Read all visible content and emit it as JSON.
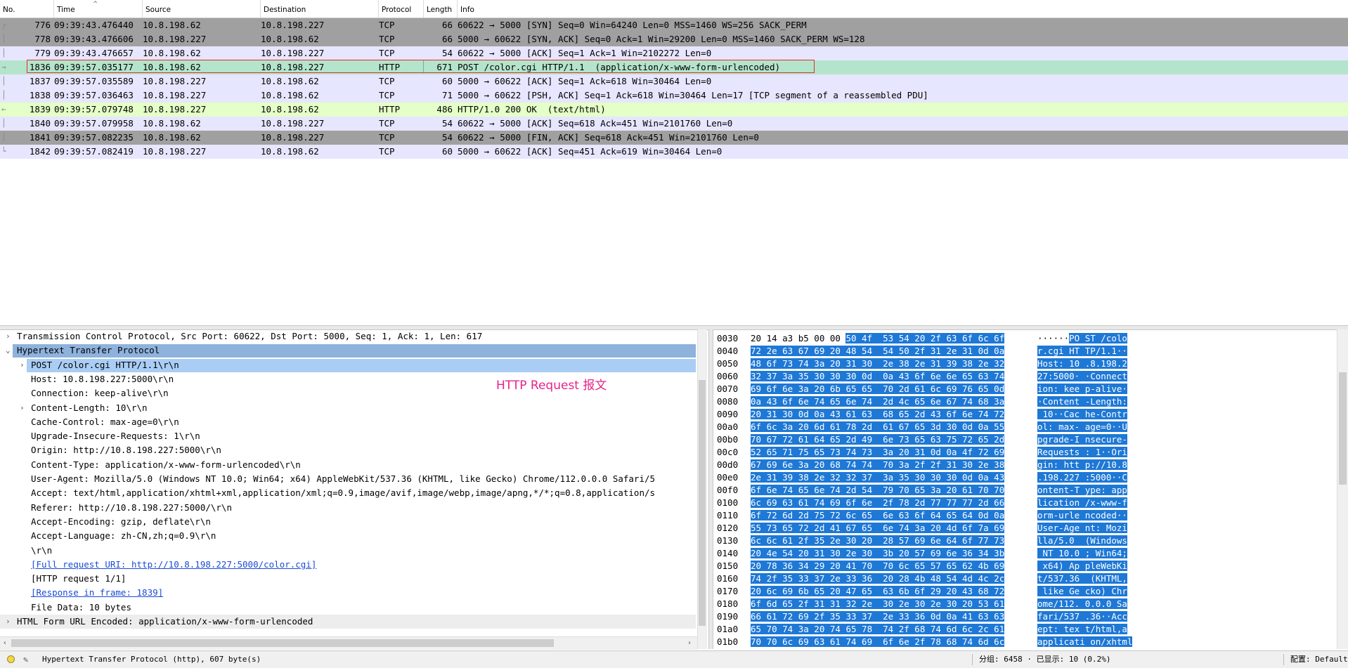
{
  "columns": [
    "No.",
    "Time",
    "Source",
    "Destination",
    "Protocol",
    "Length",
    "Info"
  ],
  "packets": [
    {
      "no": "776",
      "time": "09:39:43.476440",
      "src": "10.8.198.62",
      "dst": "10.8.198.227",
      "proto": "TCP",
      "len": "66",
      "info": "60622 → 5000 [SYN] Seq=0 Win=64240 Len=0 MSS=1460 WS=256 SACK_PERM",
      "bg": "#a0a0a0",
      "rel": "┌"
    },
    {
      "no": "778",
      "time": "09:39:43.476606",
      "src": "10.8.198.227",
      "dst": "10.8.198.62",
      "proto": "TCP",
      "len": "66",
      "info": "5000 → 60622 [SYN, ACK] Seq=0 Ack=1 Win=29200 Len=0 MSS=1460 SACK_PERM WS=128",
      "bg": "#a0a0a0",
      "rel": "│"
    },
    {
      "no": "779",
      "time": "09:39:43.476657",
      "src": "10.8.198.62",
      "dst": "10.8.198.227",
      "proto": "TCP",
      "len": "54",
      "info": "60622 → 5000 [ACK] Seq=1 Ack=1 Win=2102272 Len=0",
      "bg": "#e7e6ff",
      "rel": "│"
    },
    {
      "no": "1836",
      "time": "09:39:57.035177",
      "src": "10.8.198.62",
      "dst": "10.8.198.227",
      "proto": "HTTP",
      "len": "671",
      "info": "POST /color.cgi HTTP/1.1  (application/x-www-form-urlencoded)",
      "bg": "#b4e4cc",
      "rel": "→"
    },
    {
      "no": "1837",
      "time": "09:39:57.035589",
      "src": "10.8.198.227",
      "dst": "10.8.198.62",
      "proto": "TCP",
      "len": "60",
      "info": "5000 → 60622 [ACK] Seq=1 Ack=618 Win=30464 Len=0",
      "bg": "#e7e6ff",
      "rel": "│"
    },
    {
      "no": "1838",
      "time": "09:39:57.036463",
      "src": "10.8.198.227",
      "dst": "10.8.198.62",
      "proto": "TCP",
      "len": "71",
      "info": "5000 → 60622 [PSH, ACK] Seq=1 Ack=618 Win=30464 Len=17 [TCP segment of a reassembled PDU]",
      "bg": "#e7e6ff",
      "rel": "│"
    },
    {
      "no": "1839",
      "time": "09:39:57.079748",
      "src": "10.8.198.227",
      "dst": "10.8.198.62",
      "proto": "HTTP",
      "len": "486",
      "info": "HTTP/1.0 200 OK  (text/html)",
      "bg": "#e4ffc7",
      "rel": "←"
    },
    {
      "no": "1840",
      "time": "09:39:57.079958",
      "src": "10.8.198.62",
      "dst": "10.8.198.227",
      "proto": "TCP",
      "len": "54",
      "info": "60622 → 5000 [ACK] Seq=618 Ack=451 Win=2101760 Len=0",
      "bg": "#e7e6ff",
      "rel": "│"
    },
    {
      "no": "1841",
      "time": "09:39:57.082235",
      "src": "10.8.198.62",
      "dst": "10.8.198.227",
      "proto": "TCP",
      "len": "54",
      "info": "60622 → 5000 [FIN, ACK] Seq=618 Ack=451 Win=2101760 Len=0",
      "bg": "#a0a0a0",
      "rel": "│"
    },
    {
      "no": "1842",
      "time": "09:39:57.082419",
      "src": "10.8.198.227",
      "dst": "10.8.198.62",
      "proto": "TCP",
      "len": "60",
      "info": "5000 → 60622 [ACK] Seq=451 Ack=619 Win=30464 Len=0",
      "bg": "#e7e6ff",
      "rel": "└"
    }
  ],
  "details": [
    {
      "text": "Transmission Control Protocol, Src Port: 60622, Dst Port: 5000, Seq: 1, Ack: 1, Len: 617",
      "indent": 0,
      "arrow": "›",
      "style": "normal"
    },
    {
      "text": "Hypertext Transfer Protocol",
      "indent": 0,
      "arrow": "⌄",
      "style": "sel-dark"
    },
    {
      "text": "POST /color.cgi HTTP/1.1\\r\\n",
      "indent": 1,
      "arrow": "›",
      "style": "sel-light"
    },
    {
      "text": "Host: 10.8.198.227:5000\\r\\n",
      "indent": 1,
      "arrow": "",
      "style": "normal"
    },
    {
      "text": "Connection: keep-alive\\r\\n",
      "indent": 1,
      "arrow": "",
      "style": "normal"
    },
    {
      "text": "Content-Length: 10\\r\\n",
      "indent": 1,
      "arrow": "›",
      "style": "normal"
    },
    {
      "text": "Cache-Control: max-age=0\\r\\n",
      "indent": 1,
      "arrow": "",
      "style": "normal"
    },
    {
      "text": "Upgrade-Insecure-Requests: 1\\r\\n",
      "indent": 1,
      "arrow": "",
      "style": "normal"
    },
    {
      "text": "Origin: http://10.8.198.227:5000\\r\\n",
      "indent": 1,
      "arrow": "",
      "style": "normal"
    },
    {
      "text": "Content-Type: application/x-www-form-urlencoded\\r\\n",
      "indent": 1,
      "arrow": "",
      "style": "normal"
    },
    {
      "text": "User-Agent: Mozilla/5.0 (Windows NT 10.0; Win64; x64) AppleWebKit/537.36 (KHTML, like Gecko) Chrome/112.0.0.0 Safari/5",
      "indent": 1,
      "arrow": "",
      "style": "normal"
    },
    {
      "text": "Accept: text/html,application/xhtml+xml,application/xml;q=0.9,image/avif,image/webp,image/apng,*/*;q=0.8,application/s",
      "indent": 1,
      "arrow": "",
      "style": "normal"
    },
    {
      "text": "Referer: http://10.8.198.227:5000/\\r\\n",
      "indent": 1,
      "arrow": "",
      "style": "normal"
    },
    {
      "text": "Accept-Encoding: gzip, deflate\\r\\n",
      "indent": 1,
      "arrow": "",
      "style": "normal"
    },
    {
      "text": "Accept-Language: zh-CN,zh;q=0.9\\r\\n",
      "indent": 1,
      "arrow": "",
      "style": "normal"
    },
    {
      "text": "\\r\\n",
      "indent": 1,
      "arrow": "",
      "style": "normal"
    },
    {
      "text": "[Full request URI: http://10.8.198.227:5000/color.cgi]",
      "indent": 1,
      "arrow": "",
      "style": "link"
    },
    {
      "text": "[HTTP request 1/1]",
      "indent": 1,
      "arrow": "",
      "style": "normal"
    },
    {
      "text": "[Response in frame: 1839]",
      "indent": 1,
      "arrow": "",
      "style": "link"
    },
    {
      "text": "File Data: 10 bytes",
      "indent": 1,
      "arrow": "",
      "style": "normal"
    },
    {
      "text": "HTML Form URL Encoded: application/x-www-form-urlencoded",
      "indent": 0,
      "arrow": "›",
      "style": "grey"
    }
  ],
  "annotation": "HTTP Request 报文",
  "hex": [
    {
      "off": "0030",
      "pre": "20 14 a3 b5 00 00 ",
      "hl": "50 4f  53 54 20 2f 63 6f 6c 6f",
      "apre": "······",
      "ahl": "PO ST /colo"
    },
    {
      "off": "0040",
      "pre": "",
      "hl": "72 2e 63 67 69 20 48 54  54 50 2f 31 2e 31 0d 0a",
      "apre": "",
      "ahl": "r.cgi HT TP/1.1··"
    },
    {
      "off": "0050",
      "pre": "",
      "hl": "48 6f 73 74 3a 20 31 30  2e 38 2e 31 39 38 2e 32",
      "apre": "",
      "ahl": "Host: 10 .8.198.2"
    },
    {
      "off": "0060",
      "pre": "",
      "hl": "32 37 3a 35 30 30 30 0d  0a 43 6f 6e 6e 65 63 74",
      "apre": "",
      "ahl": "27:5000· ·Connect"
    },
    {
      "off": "0070",
      "pre": "",
      "hl": "69 6f 6e 3a 20 6b 65 65  70 2d 61 6c 69 76 65 0d",
      "apre": "",
      "ahl": "ion: kee p-alive·"
    },
    {
      "off": "0080",
      "pre": "",
      "hl": "0a 43 6f 6e 74 65 6e 74  2d 4c 65 6e 67 74 68 3a",
      "apre": "",
      "ahl": "·Content -Length:"
    },
    {
      "off": "0090",
      "pre": "",
      "hl": "20 31 30 0d 0a 43 61 63  68 65 2d 43 6f 6e 74 72",
      "apre": "",
      "ahl": " 10··Cac he-Contr"
    },
    {
      "off": "00a0",
      "pre": "",
      "hl": "6f 6c 3a 20 6d 61 78 2d  61 67 65 3d 30 0d 0a 55",
      "apre": "",
      "ahl": "ol: max- age=0··U"
    },
    {
      "off": "00b0",
      "pre": "",
      "hl": "70 67 72 61 64 65 2d 49  6e 73 65 63 75 72 65 2d",
      "apre": "",
      "ahl": "pgrade-I nsecure-"
    },
    {
      "off": "00c0",
      "pre": "",
      "hl": "52 65 71 75 65 73 74 73  3a 20 31 0d 0a 4f 72 69",
      "apre": "",
      "ahl": "Requests : 1··Ori"
    },
    {
      "off": "00d0",
      "pre": "",
      "hl": "67 69 6e 3a 20 68 74 74  70 3a 2f 2f 31 30 2e 38",
      "apre": "",
      "ahl": "gin: htt p://10.8"
    },
    {
      "off": "00e0",
      "pre": "",
      "hl": "2e 31 39 38 2e 32 32 37  3a 35 30 30 30 0d 0a 43",
      "apre": "",
      "ahl": ".198.227 :5000··C"
    },
    {
      "off": "00f0",
      "pre": "",
      "hl": "6f 6e 74 65 6e 74 2d 54  79 70 65 3a 20 61 70 70",
      "apre": "",
      "ahl": "ontent-T ype: app"
    },
    {
      "off": "0100",
      "pre": "",
      "hl": "6c 69 63 61 74 69 6f 6e  2f 78 2d 77 77 77 2d 66",
      "apre": "",
      "ahl": "lication /x-www-f"
    },
    {
      "off": "0110",
      "pre": "",
      "hl": "6f 72 6d 2d 75 72 6c 65  6e 63 6f 64 65 64 0d 0a",
      "apre": "",
      "ahl": "orm-urle ncoded··"
    },
    {
      "off": "0120",
      "pre": "",
      "hl": "55 73 65 72 2d 41 67 65  6e 74 3a 20 4d 6f 7a 69",
      "apre": "",
      "ahl": "User-Age nt: Mozi"
    },
    {
      "off": "0130",
      "pre": "",
      "hl": "6c 6c 61 2f 35 2e 30 20  28 57 69 6e 64 6f 77 73",
      "apre": "",
      "ahl": "lla/5.0  (Windows"
    },
    {
      "off": "0140",
      "pre": "",
      "hl": "20 4e 54 20 31 30 2e 30  3b 20 57 69 6e 36 34 3b",
      "apre": "",
      "ahl": " NT 10.0 ; Win64;"
    },
    {
      "off": "0150",
      "pre": "",
      "hl": "20 78 36 34 29 20 41 70  70 6c 65 57 65 62 4b 69",
      "apre": "",
      "ahl": " x64) Ap pleWebKi"
    },
    {
      "off": "0160",
      "pre": "",
      "hl": "74 2f 35 33 37 2e 33 36  20 28 4b 48 54 4d 4c 2c",
      "apre": "",
      "ahl": "t/537.36  (KHTML,"
    },
    {
      "off": "0170",
      "pre": "",
      "hl": "20 6c 69 6b 65 20 47 65  63 6b 6f 29 20 43 68 72",
      "apre": "",
      "ahl": " like Ge cko) Chr"
    },
    {
      "off": "0180",
      "pre": "",
      "hl": "6f 6d 65 2f 31 31 32 2e  30 2e 30 2e 30 20 53 61",
      "apre": "",
      "ahl": "ome/112. 0.0.0 Sa"
    },
    {
      "off": "0190",
      "pre": "",
      "hl": "66 61 72 69 2f 35 33 37  2e 33 36 0d 0a 41 63 63",
      "apre": "",
      "ahl": "fari/537 .36··Acc"
    },
    {
      "off": "01a0",
      "pre": "",
      "hl": "65 70 74 3a 20 74 65 78  74 2f 68 74 6d 6c 2c 61",
      "apre": "",
      "ahl": "ept: tex t/html,a"
    },
    {
      "off": "01b0",
      "pre": "",
      "hl": "70 70 6c 69 63 61 74 69  6f 6e 2f 78 68 74 6d 6c",
      "apre": "",
      "ahl": "applicati on/xhtml"
    }
  ],
  "status": {
    "left": "Hypertext Transfer Protocol (http), 607 byte(s)",
    "packets": "分组: 6458 · 已显示: 10 (0.2%)",
    "profile": "配置: Default"
  }
}
